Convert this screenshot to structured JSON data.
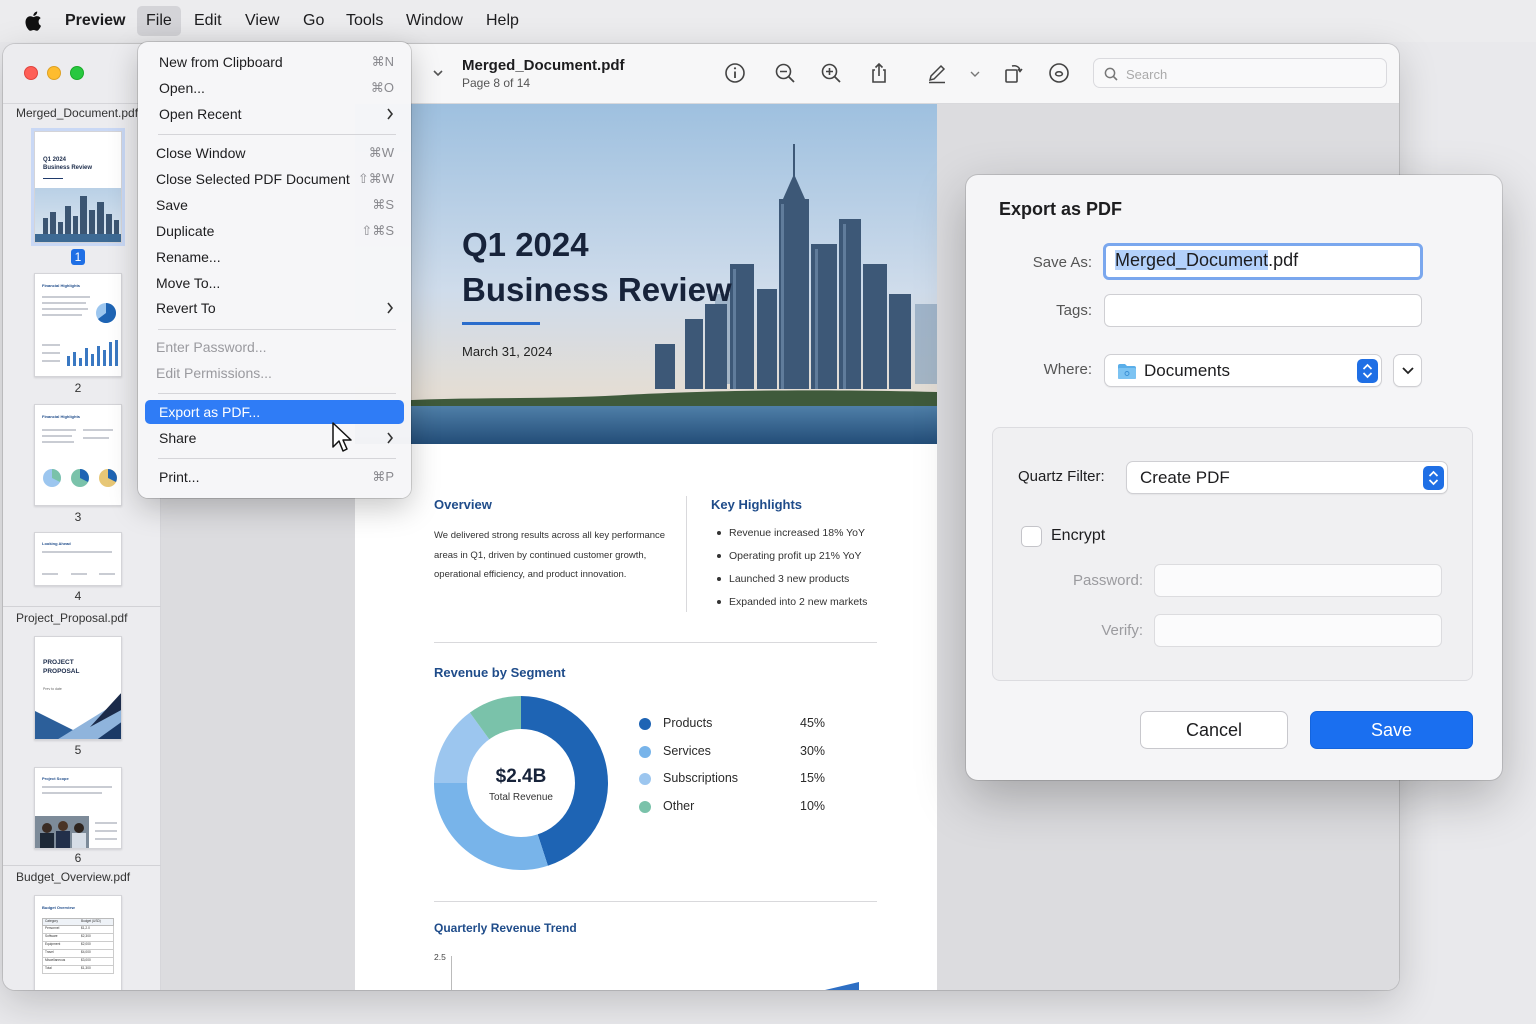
{
  "menubar": {
    "app": "Preview",
    "items": [
      "File",
      "Edit",
      "View",
      "Go",
      "Tools",
      "Window",
      "Help"
    ]
  },
  "sidebar": {
    "documents": [
      {
        "name": "Merged_Document.pdf",
        "pages": [
          "1",
          "2",
          "3",
          "4"
        ]
      },
      {
        "name": "Project_Proposal.pdf",
        "pages": [
          "5",
          "6"
        ]
      },
      {
        "name": "Budget_Overview.pdf",
        "pages": []
      }
    ],
    "selected_page": "1",
    "thumbs": {
      "p1_title": "Q1 2024\nBusiness Review",
      "p2_title": "Financial Highlights",
      "p3_title": "Financial Highlights",
      "p4_title": "Looking Ahead",
      "p5_title": "PROJECT\nPROPOSAL",
      "p5_sub": "Prev to date",
      "p6_title": "Project Scope",
      "budget_title": "Budget Overview",
      "budget_cols": [
        "Category",
        "Budget (USD)"
      ],
      "budget_rows": [
        [
          "Personnel",
          "$1,2.0"
        ],
        [
          "Software",
          "$2,300"
        ],
        [
          "Equipment",
          "$2,000"
        ],
        [
          "Travel",
          "$4,000"
        ],
        [
          "Miscellaneous",
          "$3,000"
        ],
        [
          "Total",
          "$1,300"
        ]
      ]
    }
  },
  "toolbar": {
    "title": "Merged_Document.pdf",
    "subtitle": "Page 8 of 14",
    "search_placeholder": "Search"
  },
  "page": {
    "hero_title_1": "Q1 2024",
    "hero_title_2": "Business Review",
    "date": "March 31, 2024",
    "overview_head": "Overview",
    "overview_text": "We delivered strong results across all key performance areas in Q1, driven by continued customer growth, operational efficiency, and product innovation.",
    "highlights_head": "Key Highlights",
    "highlights": [
      "Revenue increased 18% YoY",
      "Operating profit up 21% YoY",
      "Launched 3 new products",
      "Expanded into 2 new markets"
    ],
    "revenue_head": "Revenue by Segment",
    "trend_head": "Quarterly Revenue Trend",
    "trend_tick": "2.5"
  },
  "chart_data": {
    "type": "pie",
    "title": "Revenue by Segment",
    "center_value": "$2.4B",
    "center_label": "Total Revenue",
    "categories": [
      "Products",
      "Services",
      "Subscriptions",
      "Other"
    ],
    "values": [
      45,
      30,
      15,
      10
    ],
    "value_labels": [
      "45%",
      "30%",
      "15%",
      "10%"
    ],
    "colors": [
      "#1e64b4",
      "#78b4ea",
      "#9cc6ef",
      "#7ac2aa"
    ]
  },
  "file_menu": {
    "items": [
      {
        "label": "New from Clipboard",
        "shortcut": "⌘N"
      },
      {
        "label": "Open...",
        "shortcut": "⌘O"
      },
      {
        "label": "Open Recent",
        "shortcut": ""
      },
      {
        "label": "Close Window",
        "shortcut": "⌘W"
      },
      {
        "label": "Close Selected PDF Document",
        "shortcut": "⇧⌘W"
      },
      {
        "label": "Save",
        "shortcut": "⌘S"
      },
      {
        "label": "Duplicate",
        "shortcut": "⇧⌘S"
      },
      {
        "label": "Rename...",
        "shortcut": ""
      },
      {
        "label": "Move To...",
        "shortcut": ""
      },
      {
        "label": "Revert To",
        "shortcut": ""
      },
      {
        "label": "Enter Password...",
        "shortcut": ""
      },
      {
        "label": "Edit Permissions...",
        "shortcut": ""
      },
      {
        "label": "Export as PDF...",
        "shortcut": ""
      },
      {
        "label": "Share",
        "shortcut": ""
      },
      {
        "label": "Print...",
        "shortcut": "⌘P"
      }
    ]
  },
  "dialog": {
    "title": "Export as PDF",
    "save_as_label": "Save As:",
    "save_as_selected": "Merged_Document",
    "save_as_ext": ".pdf",
    "tags_label": "Tags:",
    "tags_value": "",
    "where_label": "Where:",
    "where_value": "Documents",
    "quartz_label": "Quartz Filter:",
    "quartz_value": "Create PDF",
    "encrypt_label": "Encrypt",
    "encrypt_checked": false,
    "password_label": "Password:",
    "verify_label": "Verify:",
    "cancel": "Cancel",
    "save": "Save",
    "accent": "#1a6ff0"
  }
}
